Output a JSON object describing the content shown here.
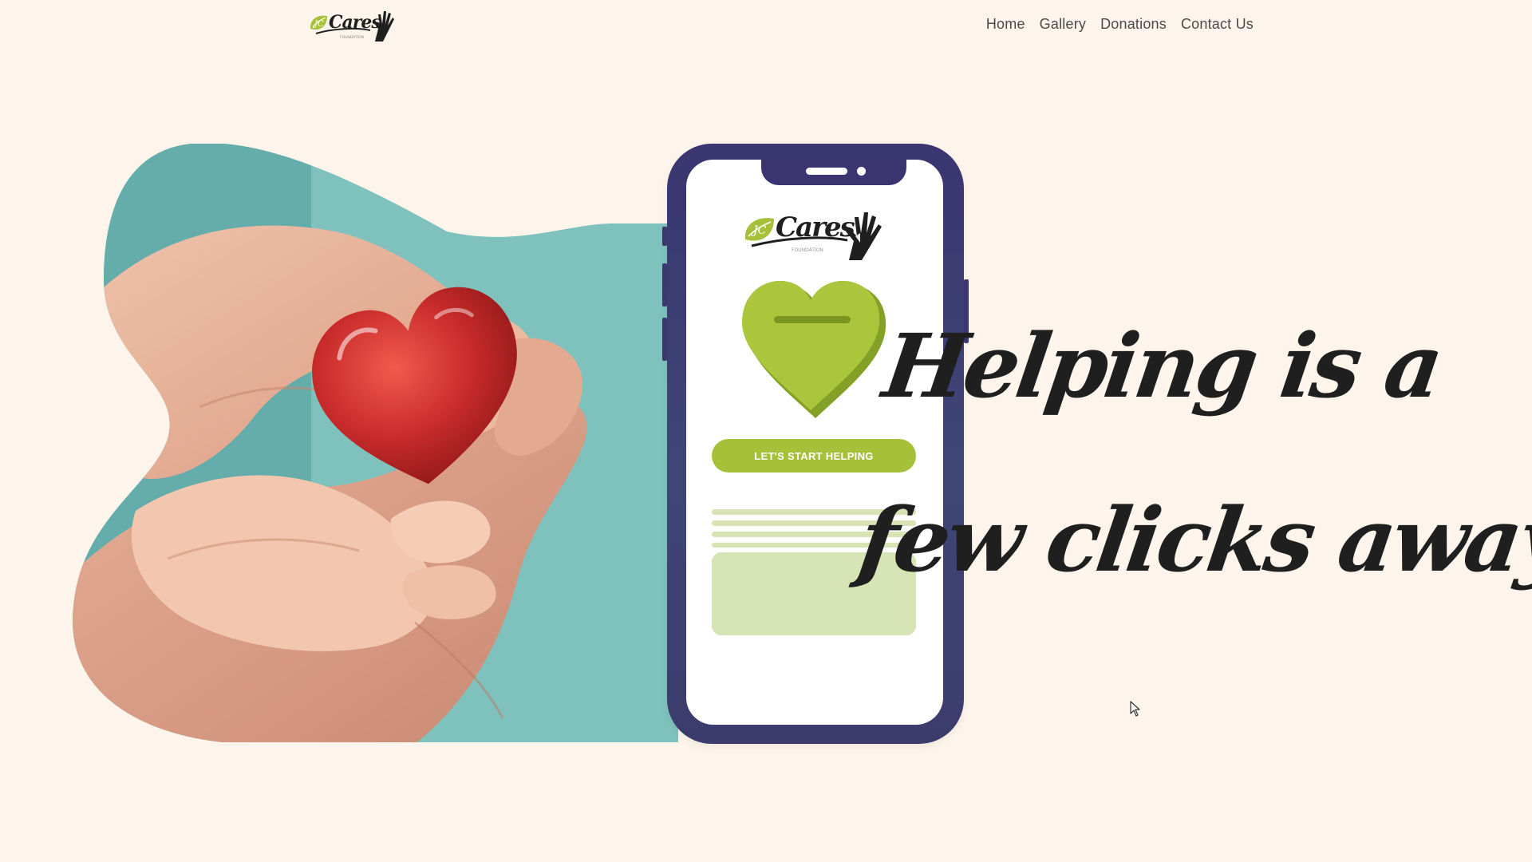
{
  "brand": {
    "logo_text": "Cares",
    "logo_mark": "JC",
    "logo_tagline": "FOUNDATION"
  },
  "nav": {
    "items": [
      {
        "label": "Home"
      },
      {
        "label": "Gallery"
      },
      {
        "label": "Donations"
      },
      {
        "label": "Contact Us"
      }
    ]
  },
  "hero": {
    "headline_line1": "Helping is a",
    "headline_line2": "few clicks away",
    "image_subject": "hands-holding-red-heart"
  },
  "phone": {
    "cta_label": "LET'S START HELPING",
    "heart_icon": "donation-heart-icon"
  },
  "colors": {
    "background": "#fdf5eb",
    "accent_green": "#a7c03a",
    "phone_frame": "#3a3570",
    "text_dark": "#1f1f1f",
    "heart_red": "#c62a2a",
    "teal": "#6fb9b5"
  }
}
